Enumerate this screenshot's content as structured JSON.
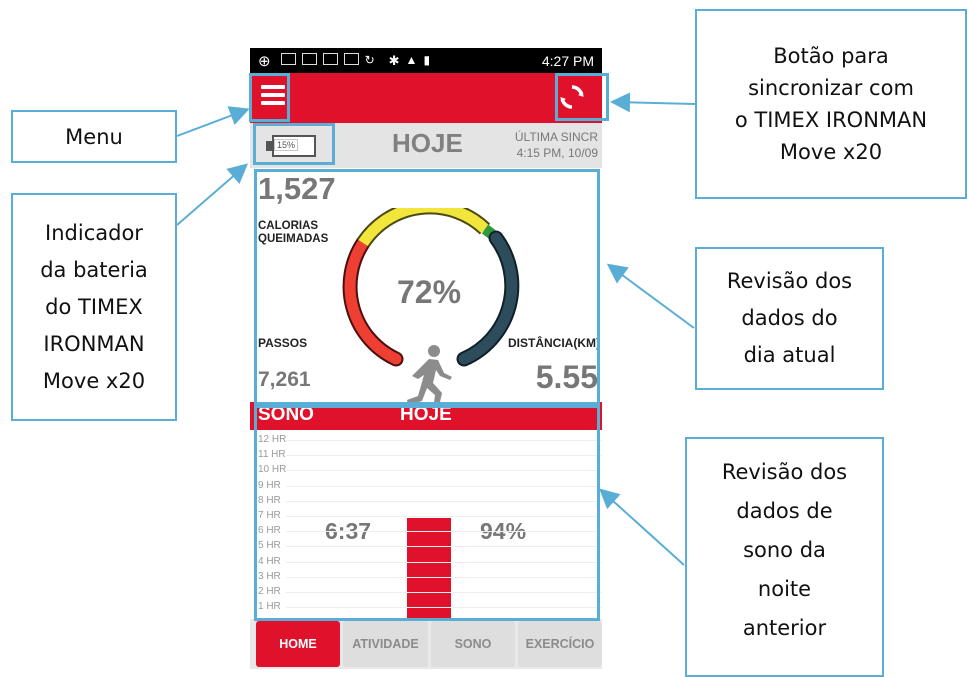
{
  "status_bar": {
    "time": "4:27 PM"
  },
  "header": {
    "menu_icon": "hamburger-menu-icon",
    "sync_icon": "sync-icon",
    "accent_color": "#e0112b"
  },
  "info_bar": {
    "battery_percent": "15%",
    "title": "HOJE",
    "last_sync_label": "ÚLTIMA SINCR",
    "last_sync_time": "4:15 PM, 10/09"
  },
  "activity_summary": {
    "calories_value": "1,527",
    "calories_label": "CALORIAS QUEIMADAS",
    "goal_percent": "72%",
    "goal_fraction": 0.72,
    "steps_label": "PASSOS",
    "steps_value": "7,261",
    "distance_label": "DISTÂNCIA(KM)",
    "distance_value": "5.55"
  },
  "sleep_header": {
    "left": "SONO",
    "center": "HOJE"
  },
  "sleep_chart": {
    "hours": [
      "12 HR",
      "11 HR",
      "10 HR",
      "9 HR",
      "8 HR",
      "7 HR",
      "6 HR",
      "5 HR",
      "4 HR",
      "3 HR",
      "2 HR",
      "1 HR"
    ],
    "sleep_time": "6:37",
    "sleep_efficiency": "94%",
    "bar_hours": 6.6
  },
  "tabs": [
    {
      "label": "HOME",
      "active": true
    },
    {
      "label": "ATIVIDADE",
      "active": false
    },
    {
      "label": "SONO",
      "active": false
    },
    {
      "label": "EXERCÍCIO",
      "active": false
    }
  ],
  "annotations": {
    "menu": "Menu",
    "sync_line1": "Botão para",
    "sync_line2": "sincronizar com",
    "sync_line3": "o TIMEX IRONMAN",
    "sync_line4": "Move x20",
    "battery_line1": "Indicador",
    "battery_line2": "da bateria",
    "battery_line3": "do TIMEX",
    "battery_line4": "IRONMAN",
    "battery_line5": "Move x20",
    "daily_line1": "Revisão dos",
    "daily_line2": "dados do",
    "daily_line3": "dia atual",
    "sleep_line1": "Revisão dos",
    "sleep_line2": "dados de",
    "sleep_line3": "sono da",
    "sleep_line4": "noite",
    "sleep_line5": "anterior"
  }
}
